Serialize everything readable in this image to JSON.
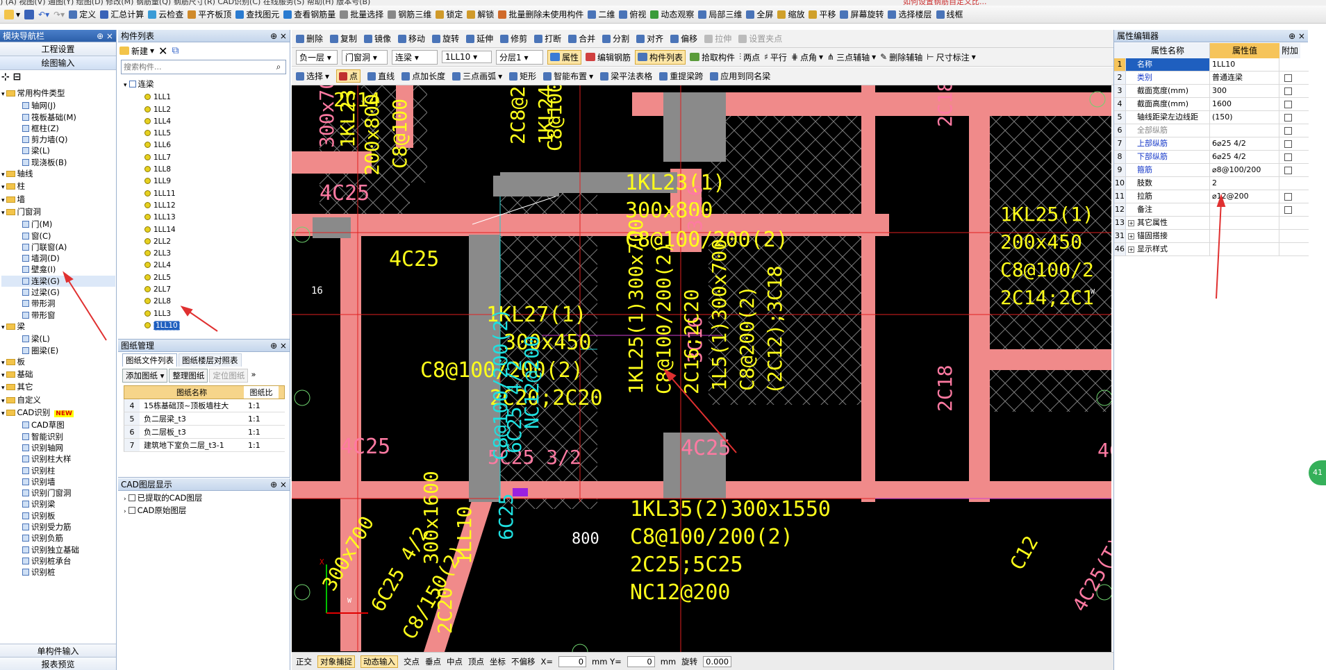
{
  "menu_fragment": ") (A) 视图(V) 通图(Y) 绘图(D) 修改(M) 钢筋量(Q) 钢筋尺寸(R) CAD识别(C) 在线服务(S) 帮助(H) 版本号(B)",
  "menu_right": "如何设置钢筋自定义比...",
  "toolbar1": [
    "定义",
    "汇总计算",
    "云检查",
    "平齐板顶",
    "查找图元",
    "查看钢筋量",
    "批量选择",
    "钢筋三维",
    "锁定",
    "解锁",
    "批量删除未使用构件",
    "二维",
    "俯视",
    "动态观察",
    "局部三维",
    "全屏",
    "缩放",
    "平移",
    "屏幕旋转",
    "选择楼层",
    "线框"
  ],
  "left_nav": {
    "title": "模块导航栏",
    "pin": "⊕ ×",
    "btn_project": "工程设置",
    "btn_draw": "绘图输入",
    "btn_single": "单构件输入",
    "btn_report": "报表预览",
    "tree": [
      {
        "label": "常用构件类型",
        "indent": 0,
        "type": "folder"
      },
      {
        "label": "轴网(J)",
        "indent": 2,
        "type": "item"
      },
      {
        "label": "筏板基础(M)",
        "indent": 2,
        "type": "item"
      },
      {
        "label": "框柱(Z)",
        "indent": 2,
        "type": "item"
      },
      {
        "label": "剪力墙(Q)",
        "indent": 2,
        "type": "item"
      },
      {
        "label": "梁(L)",
        "indent": 2,
        "type": "item"
      },
      {
        "label": "现浇板(B)",
        "indent": 2,
        "type": "item"
      },
      {
        "label": "轴线",
        "indent": 0,
        "type": "folder"
      },
      {
        "label": "柱",
        "indent": 0,
        "type": "folder"
      },
      {
        "label": "墙",
        "indent": 0,
        "type": "folder"
      },
      {
        "label": "门窗洞",
        "indent": 0,
        "type": "folder"
      },
      {
        "label": "门(M)",
        "indent": 2,
        "type": "item"
      },
      {
        "label": "窗(C)",
        "indent": 2,
        "type": "item"
      },
      {
        "label": "门联窗(A)",
        "indent": 2,
        "type": "item"
      },
      {
        "label": "墙洞(D)",
        "indent": 2,
        "type": "item"
      },
      {
        "label": "壁龛(I)",
        "indent": 2,
        "type": "item"
      },
      {
        "label": "连梁(G)",
        "indent": 2,
        "type": "item"
      },
      {
        "label": "过梁(G)",
        "indent": 2,
        "type": "item"
      },
      {
        "label": "带形洞",
        "indent": 2,
        "type": "item"
      },
      {
        "label": "带形窗",
        "indent": 2,
        "type": "item"
      },
      {
        "label": "梁",
        "indent": 0,
        "type": "folder"
      },
      {
        "label": "梁(L)",
        "indent": 2,
        "type": "item"
      },
      {
        "label": "圈梁(E)",
        "indent": 2,
        "type": "item"
      },
      {
        "label": "板",
        "indent": 0,
        "type": "folder"
      },
      {
        "label": "基础",
        "indent": 0,
        "type": "folder"
      },
      {
        "label": "其它",
        "indent": 0,
        "type": "folder"
      },
      {
        "label": "自定义",
        "indent": 0,
        "type": "folder"
      },
      {
        "label": "CAD识别",
        "indent": 0,
        "type": "folder"
      },
      {
        "label": "CAD草图",
        "indent": 2,
        "type": "item"
      },
      {
        "label": "智能识别",
        "indent": 2,
        "type": "item"
      },
      {
        "label": "识别轴网",
        "indent": 2,
        "type": "item"
      },
      {
        "label": "识别柱大样",
        "indent": 2,
        "type": "item"
      },
      {
        "label": "识别柱",
        "indent": 2,
        "type": "item"
      },
      {
        "label": "识别墙",
        "indent": 2,
        "type": "item"
      },
      {
        "label": "识别门窗洞",
        "indent": 2,
        "type": "item"
      },
      {
        "label": "识别梁",
        "indent": 2,
        "type": "item"
      },
      {
        "label": "识别板",
        "indent": 2,
        "type": "item"
      },
      {
        "label": "识别受力筋",
        "indent": 2,
        "type": "item"
      },
      {
        "label": "识别负筋",
        "indent": 2,
        "type": "item"
      },
      {
        "label": "识别独立基础",
        "indent": 2,
        "type": "item"
      },
      {
        "label": "识别桩承台",
        "indent": 2,
        "type": "item"
      },
      {
        "label": "识别桩",
        "indent": 2,
        "type": "item"
      }
    ],
    "new_badge": "NEW"
  },
  "comp_list": {
    "title": "构件列表",
    "pin": "⊕ ×",
    "new_btn": "新建",
    "search_placeholder": "搜索构件...",
    "root": "连梁",
    "items": [
      "1LL1",
      "1LL2",
      "1LL4",
      "1LL5",
      "1LL6",
      "1LL7",
      "1LL8",
      "1LL9",
      "1LL11",
      "1LL12",
      "1LL13",
      "1LL14",
      "2LL2",
      "2LL3",
      "2LL4",
      "2LL5",
      "2LL7",
      "2LL8",
      "1LL3",
      "1LL10"
    ],
    "selected": "1LL10"
  },
  "drawing_mgmt": {
    "title": "图纸管理",
    "tab1": "图纸文件列表",
    "tab2": "图纸楼层对照表",
    "btn_add": "添加图纸",
    "btn_sort": "整理图纸",
    "btn_locate": "定位图纸",
    "col_name": "图纸名称",
    "col_scale": "图纸比",
    "rows": [
      {
        "n": "4",
        "name": "15栋基础顶~顶板墙柱大",
        "scale": "1:1"
      },
      {
        "n": "5",
        "name": "负二层梁_t3",
        "scale": "1:1"
      },
      {
        "n": "6",
        "name": "负二层板_t3",
        "scale": "1:1"
      },
      {
        "n": "7",
        "name": "建筑地下室负二层_t3-1",
        "scale": "1:1"
      }
    ]
  },
  "cad_layers": {
    "title": "CAD图层显示",
    "items": [
      "已提取的CAD图层",
      "CAD原始图层"
    ]
  },
  "toolbar2": [
    "删除",
    "复制",
    "镜像",
    "移动",
    "旋转",
    "延伸",
    "修剪",
    "打断",
    "合并",
    "分割",
    "对齐",
    "偏移",
    "拉伸",
    "设置夹点"
  ],
  "toolbar3": {
    "floor": "负一层",
    "category": "门窗洞",
    "type": "连梁",
    "component": "1LL10",
    "layer": "分层1",
    "btn_attr": "属性",
    "btn_edit_rebar": "编辑钢筋",
    "btn_comp_list": "构件列表",
    "btn_pick": "拾取构件",
    "btn_two_points": "两点",
    "btn_parallel": "平行",
    "btn_point_angle": "点角",
    "btn_three_axis": "三点辅轴",
    "btn_del_axis": "删除辅轴",
    "btn_dim": "尺寸标注"
  },
  "toolbar4": [
    "选择",
    "点",
    "直线",
    "点加长度",
    "三点画弧",
    "矩形",
    "智能布置",
    "梁平法表格",
    "重提梁跨",
    "应用到同名梁"
  ],
  "props": {
    "title": "属性编辑器",
    "pin": "⊕ ×",
    "col_name": "属性名称",
    "col_value": "属性值",
    "col_extra": "附加",
    "rows": [
      {
        "n": "1",
        "k": "名称",
        "v": "1LL10",
        "style": "blue",
        "chk": false,
        "expand": false
      },
      {
        "n": "2",
        "k": "类别",
        "v": "普通连梁",
        "style": "blue",
        "chk": true,
        "expand": false
      },
      {
        "n": "3",
        "k": "截面宽度(mm)",
        "v": "300",
        "style": "",
        "chk": true,
        "expand": false
      },
      {
        "n": "4",
        "k": "截面高度(mm)",
        "v": "1600",
        "style": "",
        "chk": true,
        "expand": false
      },
      {
        "n": "5",
        "k": "轴线距梁左边线距",
        "v": "(150)",
        "style": "",
        "chk": true,
        "expand": false
      },
      {
        "n": "6",
        "k": "全部纵筋",
        "v": "",
        "style": "gray",
        "chk": true,
        "expand": false
      },
      {
        "n": "7",
        "k": "上部纵筋",
        "v": "6⌀25 4/2",
        "style": "blue",
        "chk": true,
        "expand": false
      },
      {
        "n": "8",
        "k": "下部纵筋",
        "v": "6⌀25 4/2",
        "style": "blue",
        "chk": true,
        "expand": false
      },
      {
        "n": "9",
        "k": "箍筋",
        "v": "⌀8@100/200",
        "style": "blue",
        "chk": true,
        "expand": false
      },
      {
        "n": "10",
        "k": "肢数",
        "v": "2",
        "style": "",
        "chk": false,
        "expand": false
      },
      {
        "n": "11",
        "k": "拉筋",
        "v": "⌀12@200",
        "style": "",
        "chk": true,
        "expand": false
      },
      {
        "n": "12",
        "k": "备注",
        "v": "",
        "style": "",
        "chk": true,
        "expand": false
      },
      {
        "n": "13",
        "k": "其它属性",
        "v": "",
        "style": "",
        "chk": false,
        "expand": true
      },
      {
        "n": "31",
        "k": "锚固搭接",
        "v": "",
        "style": "",
        "chk": false,
        "expand": true
      },
      {
        "n": "46",
        "k": "显示样式",
        "v": "",
        "style": "",
        "chk": false,
        "expand": true
      }
    ]
  },
  "canvas": {
    "labels": [
      {
        "t": "1KL27(1)",
        "c": "#ffff1a",
        "size": 30
      },
      {
        "t": "300x450",
        "c": "#ffff1a",
        "size": 30
      },
      {
        "t": "C8@100/200(2)",
        "c": "#ffff1a",
        "size": 30
      },
      {
        "t": "2C20;2C20",
        "c": "#ffff1a",
        "size": 30
      },
      {
        "t": "4C25",
        "c": "#ffff1a",
        "size": 30
      },
      {
        "t": "4C25",
        "c": "#ff7aa2",
        "size": 30
      },
      {
        "t": "4C25",
        "c": "#ff7aa2",
        "size": 30
      },
      {
        "t": "4C25",
        "c": "#ff7aa2",
        "size": 30
      },
      {
        "t": "1KL23(1)",
        "c": "#ffff1a",
        "size": 30
      },
      {
        "t": "300x800",
        "c": "#ffff1a",
        "size": 30
      },
      {
        "t": "C8@100/200(2)",
        "c": "#ffff1a",
        "size": 30
      },
      {
        "t": "1KL35(2)300x1550",
        "c": "#ffff1a",
        "size": 30
      },
      {
        "t": "C8@100/200(2)",
        "c": "#ffff1a",
        "size": 30
      },
      {
        "t": "2C25;5C25",
        "c": "#ffff1a",
        "size": 30
      },
      {
        "t": "NC12@200",
        "c": "#ffff1a",
        "size": 30
      },
      {
        "t": "2C18",
        "c": "#ff7aa2",
        "size": 28
      },
      {
        "t": "2C18",
        "c": "#ff7aa2",
        "size": 28
      },
      {
        "t": "3C16",
        "c": "#ff7aa2",
        "size": 28
      },
      {
        "t": "3C16",
        "c": "#ff7aa2",
        "size": 28
      },
      {
        "t": "5C25 3/2",
        "c": "#ff7aa2",
        "size": 28
      },
      {
        "t": "4C2",
        "c": "#ff7aa2",
        "size": 28
      },
      {
        "t": "1KL25(1)",
        "c": "#ffff1a",
        "size": 28
      },
      {
        "t": "200x450",
        "c": "#ffff1a",
        "size": 28
      },
      {
        "t": "C8@100/2",
        "c": "#ffff1a",
        "size": 28
      },
      {
        "t": "2C14;2C1",
        "c": "#ffff1a",
        "size": 28
      },
      {
        "t": "NC12@200",
        "c": "#1fe0e0",
        "size": 28
      },
      {
        "t": "C8@100/200(2)",
        "c": "#1fe0e0",
        "size": 28
      },
      {
        "t": "6C25 4/2",
        "c": "#1fe0e0",
        "size": 28
      },
      {
        "t": "6C25",
        "c": "#1fe0e0",
        "size": 28
      },
      {
        "t": "1KL25(1)300x700",
        "c": "#ffff1a",
        "size": 28
      },
      {
        "t": "C8@100/200(2)",
        "c": "#ffff1a",
        "size": 28
      },
      {
        "t": "2C16;2C20",
        "c": "#ffff1a",
        "size": 28
      },
      {
        "t": "1L5(1)300x700",
        "c": "#ffff1a",
        "size": 28
      },
      {
        "t": "C8@200(2)",
        "c": "#ffff1a",
        "size": 28
      },
      {
        "t": "(2C12);3C18",
        "c": "#ffff1a",
        "size": 28
      },
      {
        "t": "1LL10",
        "c": "#ffff1a",
        "size": 28
      },
      {
        "t": "300x1600",
        "c": "#ffff1a",
        "size": 28
      },
      {
        "t": "300x700",
        "c": "#ffff1a",
        "size": 28
      },
      {
        "t": "6C25 4/2",
        "c": "#ffff1a",
        "size": 28
      },
      {
        "t": "C8/150(2)",
        "c": "#ffff1a",
        "size": 28
      },
      {
        "t": "2C20",
        "c": "#ffff1a",
        "size": 28
      },
      {
        "t": "C12",
        "c": "#ffff1a",
        "size": 28
      },
      {
        "t": "4C25(T)",
        "c": "#ff7aa2",
        "size": 28
      },
      {
        "t": "300x700",
        "c": "#ff7aa2",
        "size": 28
      },
      {
        "t": "1KL23",
        "c": "#ffff1a",
        "size": 28
      },
      {
        "t": "200x800",
        "c": "#ffff1a",
        "size": 28
      },
      {
        "t": "C8@100",
        "c": "#ffff1a",
        "size": 28
      },
      {
        "t": "2C14",
        "c": "#ffff1a",
        "size": 28
      },
      {
        "t": "2C8@2C18",
        "c": "#ffff1a",
        "size": 28
      },
      {
        "t": "1KL24(1)",
        "c": "#ffff1a",
        "size": 28
      },
      {
        "t": "C8@100",
        "c": "#ffff1a",
        "size": 28
      },
      {
        "t": "800",
        "c": "#ffffff",
        "size": 22
      },
      {
        "t": "16",
        "c": "#ffffff",
        "size": 14
      },
      {
        "t": "W",
        "c": "#ffffff",
        "size": 10
      },
      {
        "t": "W",
        "c": "#ffffff",
        "size": 10
      },
      {
        "t": "X",
        "c": "#e00000",
        "size": 11
      },
      {
        "t": "Y",
        "c": "#00c000",
        "size": 11
      },
      {
        "t": "4C25",
        "c": "#ff7aa2",
        "size": 28
      }
    ]
  },
  "status": {
    "items": [
      "正交",
      "对象捕捉",
      "动态输入",
      "交点",
      "垂点",
      "中点",
      "顶点",
      "坐标",
      "不偏移"
    ],
    "x_label": "X=",
    "x_val": "0",
    "mm1": "mm Y=",
    "y_val": "0",
    "mm2": "mm",
    "rotate": "旋转",
    "rot_val": "0.000"
  },
  "side_badge": "41"
}
